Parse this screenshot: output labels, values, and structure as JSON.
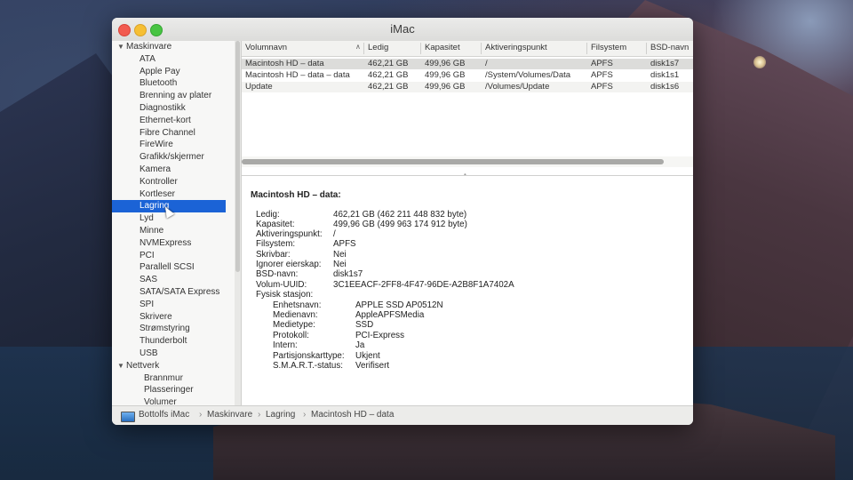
{
  "window": {
    "title": "iMac"
  },
  "sidebar": {
    "groups": [
      {
        "label": "Maskinvare",
        "items": [
          "ATA",
          "Apple Pay",
          "Bluetooth",
          "Brenning av plater",
          "Diagnostikk",
          "Ethernet-kort",
          "Fibre Channel",
          "FireWire",
          "Grafikk/skjermer",
          "Kamera",
          "Kontroller",
          "Kortleser",
          "Lagring",
          "Lyd",
          "Minne",
          "NVMExpress",
          "PCI",
          "Parallell SCSI",
          "SAS",
          "SATA/SATA Express",
          "SPI",
          "Skrivere",
          "Strømstyring",
          "Thunderbolt",
          "USB"
        ]
      },
      {
        "label": "Nettverk",
        "items": [
          "Brannmur",
          "Plasseringer",
          "Volumer"
        ]
      }
    ],
    "selected": "Lagring"
  },
  "table": {
    "headers": [
      "Volumnavn",
      "Ledig",
      "Kapasitet",
      "Aktiveringspunkt",
      "Filsystem",
      "BSD-navn"
    ],
    "rows": [
      [
        "Macintosh HD – data",
        "462,21 GB",
        "499,96 GB",
        "/",
        "APFS",
        "disk1s7"
      ],
      [
        "Macintosh HD – data – data",
        "462,21 GB",
        "499,96 GB",
        "/System/Volumes/Data",
        "APFS",
        "disk1s1"
      ],
      [
        "Update",
        "462,21 GB",
        "499,96 GB",
        "/Volumes/Update",
        "APFS",
        "disk1s6"
      ]
    ]
  },
  "detail": {
    "title": "Macintosh HD – data:",
    "fields": [
      [
        "Ledig:",
        "462,21 GB (462 211 448 832 byte)"
      ],
      [
        "Kapasitet:",
        "499,96 GB (499 963 174 912 byte)"
      ],
      [
        "Aktiveringspunkt:",
        "/"
      ],
      [
        "Filsystem:",
        "APFS"
      ],
      [
        "Skrivbar:",
        "Nei"
      ],
      [
        "Ignorer eierskap:",
        "Nei"
      ],
      [
        "BSD-navn:",
        "disk1s7"
      ],
      [
        "Volum-UUID:",
        "3C1EEACF-2FF8-4F47-96DE-A2B8F1A7402A"
      ],
      [
        "Fysisk stasjon:",
        ""
      ]
    ],
    "physical": [
      [
        "Enhetsnavn:",
        "APPLE SSD AP0512N"
      ],
      [
        "Medienavn:",
        "AppleAPFSMedia"
      ],
      [
        "Medietype:",
        "SSD"
      ],
      [
        "Protokoll:",
        "PCI-Express"
      ],
      [
        "Intern:",
        "Ja"
      ],
      [
        "Partisjonskarttype:",
        "Ukjent"
      ],
      [
        "S.M.A.R.T.-status:",
        "Verifisert"
      ]
    ]
  },
  "statusbar": {
    "crumbs": [
      "Bottolfs iMac",
      "Maskinvare",
      "Lagring",
      "Macintosh HD – data"
    ]
  }
}
